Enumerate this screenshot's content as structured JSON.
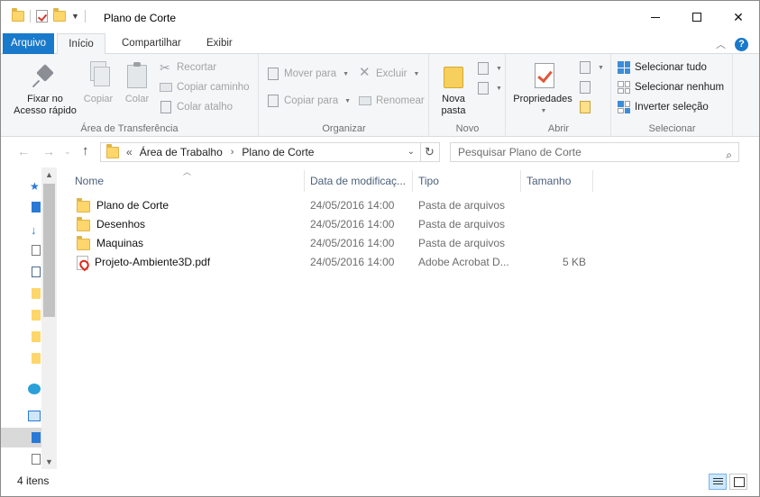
{
  "window": {
    "title": "Plano de Corte"
  },
  "ribbon_tabs": [
    {
      "label": "Arquivo"
    },
    {
      "label": "Início"
    },
    {
      "label": "Compartilhar"
    },
    {
      "label": "Exibir"
    }
  ],
  "ribbon": {
    "clipboard": {
      "pin_label_1": "Fixar no",
      "pin_label_2": "Acesso rápido",
      "copy": "Copiar",
      "paste": "Colar",
      "cut": "Recortar",
      "copy_path": "Copiar caminho",
      "paste_shortcut": "Colar atalho",
      "group_label": "Área de Transferência"
    },
    "organize": {
      "move_to": "Mover para",
      "copy_to": "Copiar para",
      "delete": "Excluir",
      "rename": "Renomear",
      "group_label": "Organizar"
    },
    "new": {
      "new_folder_1": "Nova",
      "new_folder_2": "pasta",
      "group_label": "Novo"
    },
    "open": {
      "properties": "Propriedades",
      "group_label": "Abrir"
    },
    "select": {
      "select_all": "Selecionar tudo",
      "select_none": "Selecionar nenhum",
      "invert": "Inverter seleção",
      "group_label": "Selecionar"
    }
  },
  "address": {
    "prefix": "«",
    "crumbs": [
      "Área de Trabalho",
      "Plano de Corte"
    ],
    "search_placeholder": "Pesquisar Plano de Corte"
  },
  "columns": {
    "name": "Nome",
    "date": "Data de modificaç...",
    "type": "Tipo",
    "size": "Tamanho"
  },
  "files": [
    {
      "name": "Plano de Corte",
      "date": "24/05/2016 14:00",
      "type": "Pasta de arquivos",
      "size": "",
      "icon": "folder-icon"
    },
    {
      "name": "Desenhos",
      "date": "24/05/2016 14:00",
      "type": "Pasta de arquivos",
      "size": "",
      "icon": "folder-icon"
    },
    {
      "name": "Maquinas",
      "date": "24/05/2016 14:00",
      "type": "Pasta de arquivos",
      "size": "",
      "icon": "folder-icon"
    },
    {
      "name": "Projeto-Ambiente3D.pdf",
      "date": "24/05/2016 14:00",
      "type": "Adobe Acrobat D...",
      "size": "5 KB",
      "icon": "pdf-icon"
    }
  ],
  "status": {
    "item_count": "4 itens"
  },
  "colors": {
    "accent": "#1979ca",
    "folder": "#ffd66b",
    "pdf": "#e0261b"
  }
}
